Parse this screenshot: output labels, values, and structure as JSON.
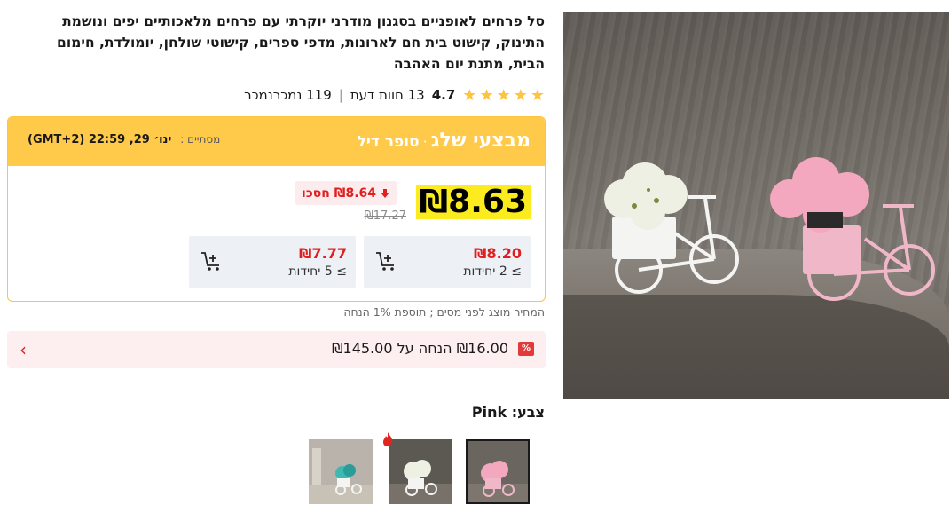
{
  "product": {
    "title": "סל פרחים לאופניים בסגנון מודרני יוקרתי עם פרחים מלאכותיים יפים ונושמת התינוק, קישוט בית חם לארונות, מדפי ספרים, קישוטי שולחן, יומולדת, חימום הבית, מתנת יום האהבה",
    "rating": "4.7",
    "reviews": "13 חוות דעת",
    "sold": "119 נמכרנמכר"
  },
  "deal": {
    "brand_main": "מבצעי שלג",
    "brand_dot": "·",
    "brand_sub": "סופר דיל",
    "timer_label": "מסתיים :",
    "timer_value": "ינו׳ 29, 22:59 (GMT+2)",
    "price": "₪8.63",
    "save_label": "₪8.64 חסכו",
    "original_price": "₪17.27",
    "tiers": [
      {
        "price": "₪8.20",
        "qty": "≥ 2 יחידות"
      },
      {
        "price": "₪7.77",
        "qty": "≥ 5 יחידות"
      }
    ]
  },
  "tax_note": "המחיר מוצג לפני מסים ; תוספת 1% הנחה",
  "coupon": {
    "icon": "%",
    "text": "₪16.00 הנחה על ₪145.00"
  },
  "color": {
    "label": "צבע: Pink",
    "options": [
      {
        "name": "Pink",
        "selected": true
      },
      {
        "name": "White",
        "selected": false,
        "hot": true
      },
      {
        "name": "Blue",
        "selected": false
      }
    ]
  },
  "icons": {
    "star": "star-icon",
    "cart": "cart-plus-icon",
    "chevron": "chevron-left-icon",
    "arrow": "arrow-down-icon",
    "fire": "fire-icon"
  },
  "colors": {
    "deal_yellow": "#ffc94a",
    "price_highlight": "#fcec1f",
    "accent_red": "#e02020",
    "star": "#fdc43f"
  }
}
